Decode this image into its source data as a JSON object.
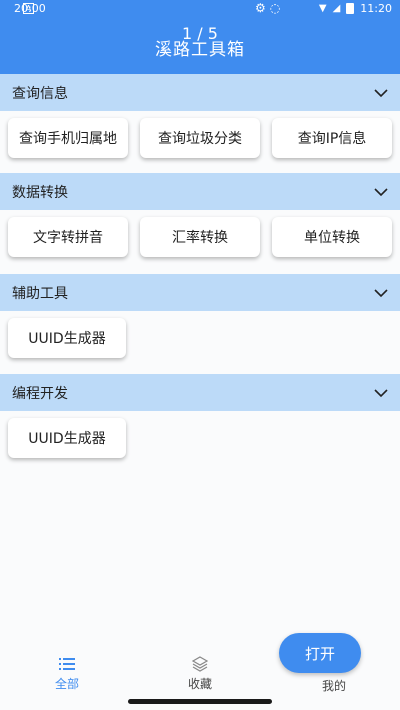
{
  "status_bar": {
    "time_left": "20:00",
    "box_letter": "A",
    "time_right": "11:20"
  },
  "header": {
    "page_indicator": "1 / 5",
    "title": "溪路工具箱",
    "color": "#3f8cef"
  },
  "sections": [
    {
      "title": "查询信息",
      "buttons": [
        "查询手机归属地",
        "查询垃圾分类",
        "查询IP信息"
      ]
    },
    {
      "title": "数据转换",
      "buttons": [
        "文字转拼音",
        "汇率转换",
        "单位转换"
      ]
    },
    {
      "title": "辅助工具",
      "buttons": [
        "UUID生成器"
      ]
    },
    {
      "title": "编程开发",
      "buttons": [
        "UUID生成器"
      ]
    }
  ],
  "bottom_nav": {
    "all_label": "全部",
    "favorites_label": "收藏",
    "mine_label": "我的",
    "fab_label": "打开",
    "active_color": "#3f8cef"
  }
}
